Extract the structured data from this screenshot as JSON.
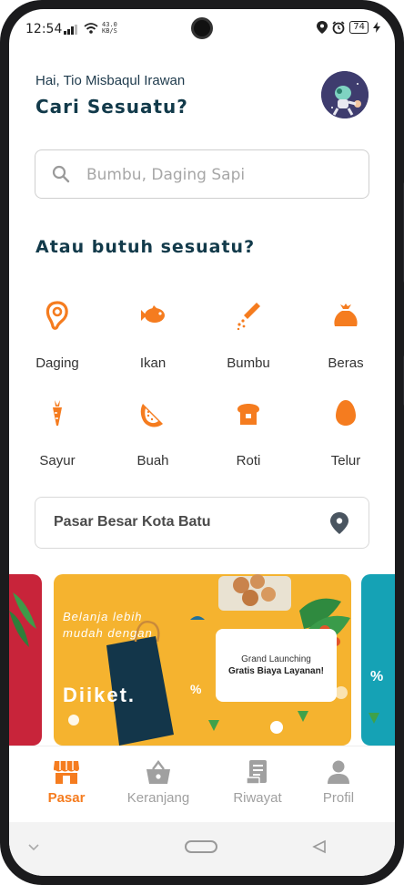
{
  "status_bar": {
    "time": "12:54",
    "net_speed_top": "43.0",
    "net_speed_bottom": "KB/S",
    "battery": "74"
  },
  "header": {
    "greeting": "Hai, Tio Misbaqul Irawan",
    "title": "Cari Sesuatu?"
  },
  "search": {
    "placeholder": "Bumbu, Daging Sapi"
  },
  "section_title": "Atau butuh sesuatu?",
  "categories": [
    {
      "label": "Daging",
      "icon": "meat-icon"
    },
    {
      "label": "Ikan",
      "icon": "fish-icon"
    },
    {
      "label": "Bumbu",
      "icon": "spice-icon"
    },
    {
      "label": "Beras",
      "icon": "rice-sack-icon"
    },
    {
      "label": "Sayur",
      "icon": "carrot-icon"
    },
    {
      "label": "Buah",
      "icon": "watermelon-icon"
    },
    {
      "label": "Roti",
      "icon": "bread-icon"
    },
    {
      "label": "Telur",
      "icon": "egg-icon"
    }
  ],
  "location": {
    "market": "Pasar Besar Kota Batu"
  },
  "banner": {
    "tagline_1": "Belanja lebih",
    "tagline_2": "mudah dengan",
    "brand": "Diiket.",
    "card_line_1": "Grand Launching",
    "card_line_2": "Gratis Biaya Layanan!",
    "percent": "%"
  },
  "bottom_nav": [
    {
      "label": "Pasar",
      "icon": "store-icon",
      "active": true
    },
    {
      "label": "Keranjang",
      "icon": "basket-icon",
      "active": false
    },
    {
      "label": "Riwayat",
      "icon": "receipt-icon",
      "active": false
    },
    {
      "label": "Profil",
      "icon": "person-icon",
      "active": false
    }
  ],
  "colors": {
    "accent": "#f57c1f",
    "heading": "#123a4a",
    "inactive": "#a0a0a0",
    "banner_yellow": "#f5b32f"
  }
}
